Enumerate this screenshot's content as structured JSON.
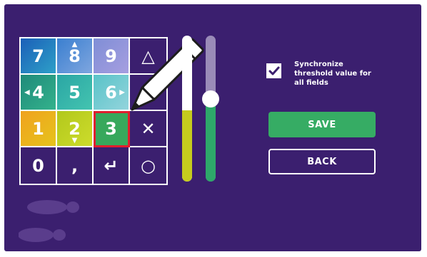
{
  "keypad": {
    "keys": [
      {
        "label": "7",
        "mini": "",
        "mini_pos": ""
      },
      {
        "label": "8",
        "mini": "▲",
        "mini_pos": "top"
      },
      {
        "label": "9",
        "mini": "",
        "mini_pos": ""
      },
      {
        "label": "△",
        "mini": "",
        "mini_pos": ""
      },
      {
        "label": "4",
        "mini": "◀",
        "mini_pos": "left"
      },
      {
        "label": "5",
        "mini": "",
        "mini_pos": ""
      },
      {
        "label": "6",
        "mini": "▶",
        "mini_pos": "right"
      },
      {
        "label": "",
        "mini": "",
        "mini_pos": ""
      },
      {
        "label": "1",
        "mini": "",
        "mini_pos": ""
      },
      {
        "label": "2",
        "mini": "▼",
        "mini_pos": "bottom"
      },
      {
        "label": "3",
        "mini": "",
        "mini_pos": ""
      },
      {
        "label": "✕",
        "mini": "",
        "mini_pos": ""
      },
      {
        "label": "0",
        "mini": "",
        "mini_pos": ""
      },
      {
        "label": ",",
        "mini": "",
        "mini_pos": ""
      },
      {
        "label": "↵",
        "mini": "",
        "mini_pos": ""
      },
      {
        "label": "○",
        "mini": "",
        "mini_pos": ""
      }
    ],
    "selected_key": "3"
  },
  "sliders": {
    "threshold_1": {
      "level": 0.49,
      "color": "#c5cc1e"
    },
    "threshold_2": {
      "level": 0.6,
      "color": "#2ea86a"
    }
  },
  "sync": {
    "checked": true,
    "label": "Synchronize threshold value for all fields"
  },
  "buttons": {
    "save_label": "SAVE",
    "back_label": "BACK"
  },
  "icons": {
    "pen": "pencil-icon",
    "footprints": "footprints-icon",
    "check": "checkmark-icon"
  },
  "colors": {
    "background": "#3b1f6f",
    "save": "#36ac64",
    "selection": "#e01e2e"
  }
}
